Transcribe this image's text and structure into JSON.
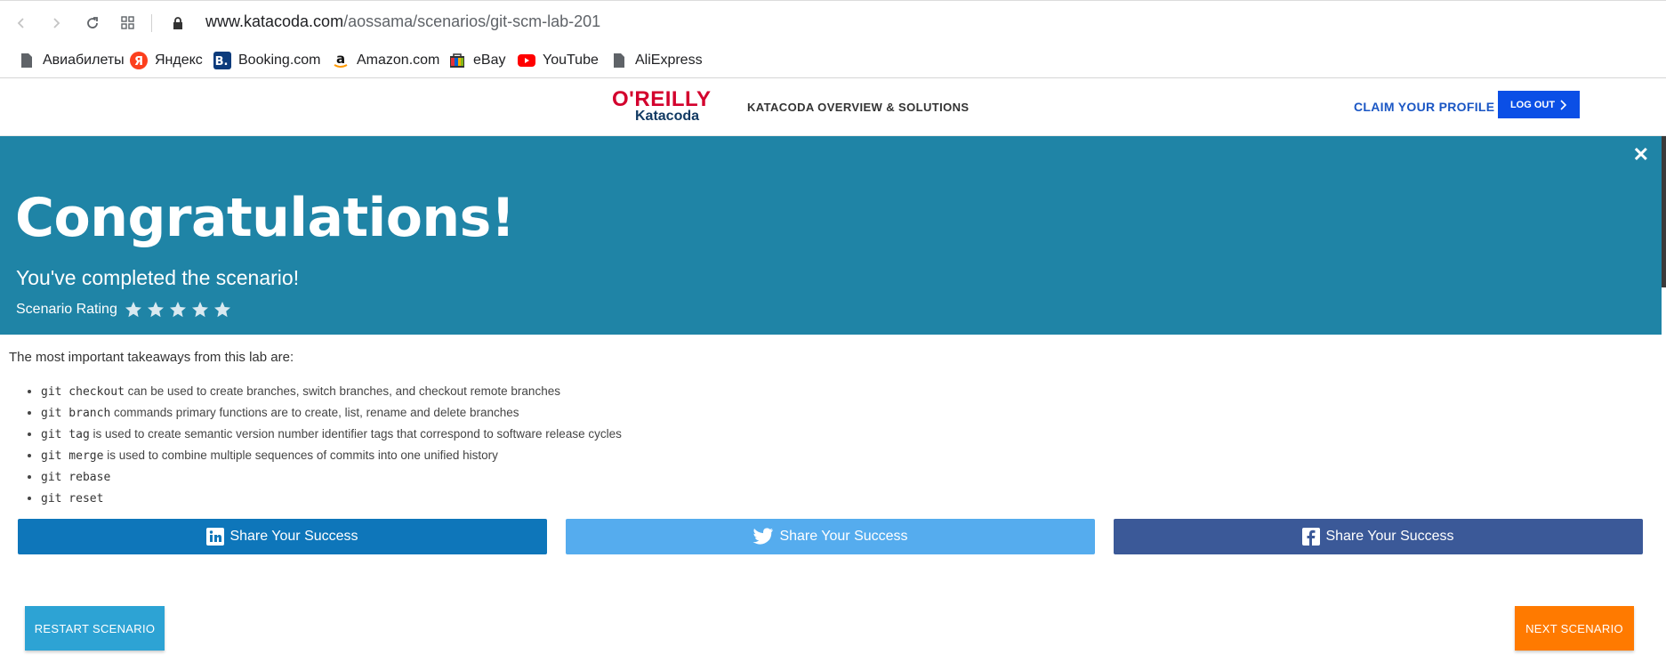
{
  "browser": {
    "url_host": "www.katacoda.com",
    "url_path": "/aossama/scenarios/git-scm-lab-201",
    "bookmarks": [
      {
        "label": "Авиабилеты",
        "icon": "page-icon"
      },
      {
        "label": "Яндекс",
        "icon": "yandex-icon"
      },
      {
        "label": "Booking.com",
        "icon": "booking-icon"
      },
      {
        "label": "Amazon.com",
        "icon": "amazon-icon"
      },
      {
        "label": "eBay",
        "icon": "ebay-icon"
      },
      {
        "label": "YouTube",
        "icon": "youtube-icon"
      },
      {
        "label": "AliExpress",
        "icon": "page-icon"
      }
    ]
  },
  "header": {
    "logo_top": "O'REILLY",
    "logo_bottom": "Katacoda",
    "nav_overview": "KATACODA OVERVIEW & SOLUTIONS",
    "claim_profile": "CLAIM YOUR PROFILE",
    "logout": "LOG OUT"
  },
  "banner": {
    "title": "Congratulations!",
    "subtitle": "You've completed the scenario!",
    "rating_label": "Scenario Rating",
    "stars": 5
  },
  "content": {
    "intro": "The most important takeaways from this lab are:",
    "takeaways": [
      {
        "code": "git checkout",
        "text": " can be used to create branches, switch branches, and checkout remote branches"
      },
      {
        "code": "git branch",
        "text": " commands primary functions are to create, list, rename and delete branches"
      },
      {
        "code": "git tag",
        "text": " is used to create semantic version number identifier tags that correspond to software release cycles"
      },
      {
        "code": "git merge",
        "text": " is used to combine multiple sequences of commits into one unified history"
      },
      {
        "code": "git rebase",
        "text": ""
      },
      {
        "code": "git reset",
        "text": ""
      }
    ]
  },
  "share": {
    "linkedin": "Share Your Success",
    "twitter": "Share Your Success",
    "facebook": "Share Your Success"
  },
  "actions": {
    "restart": "RESTART SCENARIO",
    "next": "NEXT SCENARIO"
  },
  "colors": {
    "banner": "#1f84a6",
    "linkedin": "#0e76ba",
    "twitter": "#55acee",
    "facebook": "#3b5998",
    "restart": "#2da3d4",
    "next": "#ff7a00"
  }
}
